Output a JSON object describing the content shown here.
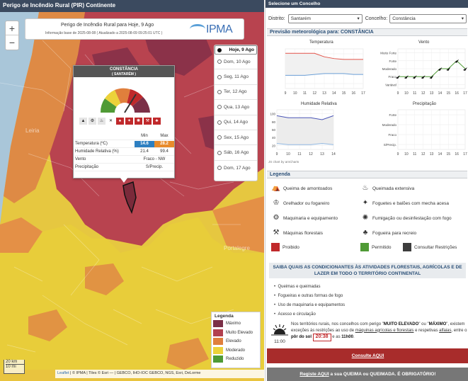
{
  "left_panel": {
    "header": "Perigo de Incêndio Rural (PIR) Continente",
    "zoom_in": "+",
    "zoom_out": "−",
    "title_line": "Perigo de Incêndio Rural para Hoje, 9 Ago",
    "info_line": "Informação base de 2025-08-08 ( Atualizado a 2025-08-09 09:25:01 UTC )",
    "logo_text": "IPMA",
    "days": [
      {
        "label": "Hoje, 9 Ago",
        "selected": true
      },
      {
        "label": "Dom, 10 Ago",
        "selected": false
      },
      {
        "label": "Seg, 11 Ago",
        "selected": false
      },
      {
        "label": "Ter, 12 Ago",
        "selected": false
      },
      {
        "label": "Qua, 13 Ago",
        "selected": false
      },
      {
        "label": "Qui, 14 Ago",
        "selected": false
      },
      {
        "label": "Sex, 15 Ago",
        "selected": false
      },
      {
        "label": "Sáb, 16 Ago",
        "selected": false
      },
      {
        "label": "Dom, 17 Ago",
        "selected": false
      }
    ],
    "popup": {
      "title": "CONSTÂNCIA",
      "subtitle": "( SANTARÉM )",
      "min_label": "Min",
      "max_label": "Max",
      "rows": {
        "temp_label": "Temperatura (ºC)",
        "temp_min": "14.6",
        "temp_max": "28.2",
        "hum_label": "Humidade Relativa (%)",
        "hum_min": "21.4",
        "hum_max": "99.4",
        "wind_label": "Vento",
        "wind_val": "Fraco - NW",
        "precip_label": "Precipitação",
        "precip_val": "S/Precip."
      }
    },
    "legend": {
      "title": "Legenda",
      "items": [
        {
          "label": "Máximo",
          "color": "#7b2f47"
        },
        {
          "label": "Muito Elevado",
          "color": "#b2404e"
        },
        {
          "label": "Elevado",
          "color": "#e07f3c"
        },
        {
          "label": "Moderado",
          "color": "#ecd23a"
        },
        {
          "label": "Reduzido",
          "color": "#4f9a35"
        }
      ]
    },
    "scale_km": "20 km",
    "scale_mi": "10 mi",
    "attribution_leaflet": "Leaflet",
    "attribution_rest": "| © IPMA | Tiles © Esri — | GEBCO, IHO-IOC GEBCO, NGS, Esri, DeLorme",
    "map_labels": {
      "leiria": "Leiria",
      "portalegre": "Portalegre"
    }
  },
  "right_panel": {
    "header": "Selecione um Concelho",
    "distrito_label": "Distrito:",
    "distrito_value": "Santarém",
    "concelho_label": "Concelho:",
    "concelho_value": "Constância",
    "forecast_section": "Previsão meteorológica para: CONSTÂNCIA",
    "charts": {
      "temperatura": {
        "title": "Temperatura",
        "x": [
          9,
          10,
          11,
          12,
          13,
          14,
          15,
          16,
          17
        ],
        "max_series": [
          40,
          40,
          40,
          40,
          36,
          34,
          33,
          33,
          33
        ],
        "min_series": [
          15,
          15,
          15,
          16,
          17,
          17,
          17,
          16,
          16
        ],
        "y_ticks": [
          "",
          "",
          "",
          ""
        ]
      },
      "vento": {
        "title": "Vento",
        "x": [
          9,
          10,
          11,
          12,
          13,
          14,
          15,
          16,
          17
        ],
        "y_ticks": [
          "Muito Forte",
          "Forte",
          "Moderado",
          "Fraco",
          "Variável"
        ],
        "level": [
          1,
          1,
          1,
          1,
          1,
          2,
          2,
          3,
          2
        ]
      },
      "humidade": {
        "title": "Humidade Relativa",
        "x": [
          9,
          10,
          11,
          12,
          13,
          14
        ],
        "y_ticks": [
          "100",
          "80",
          "60",
          "40",
          "20"
        ],
        "max_series": [
          95,
          90,
          90,
          90,
          85,
          95
        ],
        "min_series": [
          25,
          22,
          22,
          22,
          25,
          22
        ]
      },
      "precipitacao": {
        "title": "Precipitação",
        "x": [
          9,
          10,
          11,
          12,
          13,
          14,
          15,
          16,
          17
        ],
        "y_ticks": [
          "Forte",
          "Moderado",
          "Fraco",
          "S/Precip."
        ]
      },
      "credit": "JS chart by amCharts"
    },
    "legend_section": "Legenda",
    "legend_items": [
      "Queima de amontoados",
      "Queimada extensiva",
      "Grelhador ou fogareiro",
      "Foguetes e balões com mecha acesa",
      "Maquinaria e equipamento",
      "Fumigação ou desinfestação com fogo",
      "Máquinas florestais",
      "Fogueira para recreio"
    ],
    "status_items": [
      {
        "label": "Proibido",
        "color": "#c0292b"
      },
      {
        "label": "Permitido",
        "color": "#4f9a35"
      },
      {
        "label": "Consultar Restrições",
        "color": "#3d3d3d"
      }
    ],
    "saiba": "SAIBA QUAIS AS CONDICIONANTES ÀS ATIVIDADES FLORESTAIS, AGRÍCOLAS E DE LAZER EM TODO O TERRITÓRIO CONTINENTAL",
    "bullets": [
      "Queimas e queimadas",
      "Fogueiras e outras formas de fogo",
      "Uso de maquinaria e equipamentos",
      "Acesso e circulação"
    ],
    "note": {
      "p1": "Nos territórios rurais, nos concelhos com perigo \"",
      "muito": "MUITO ELEVADO",
      "p2": "\" ou \"",
      "maximo": "MÁXIMO",
      "p3": "\", existem exceções às restrições ao uso de ",
      "maquinas": "máquinas agrícolas e florestais",
      "p4": " e respetivas ",
      "alfaias": "alfaias",
      "p5": ", entre o ",
      "por_do_sol": "pôr do sol",
      "hora": "20:38",
      "p6": " e as ",
      "hora2": "11h00",
      "p7": "."
    },
    "sun_time": "11:00",
    "consulte": "Consulte AQUI",
    "registo_pre": "Registe ",
    "registo_aqui": "AQUI",
    "registo_post": " a sua QUEIMA ou QUEIMADA. É OBRIGATÓRIO!"
  }
}
